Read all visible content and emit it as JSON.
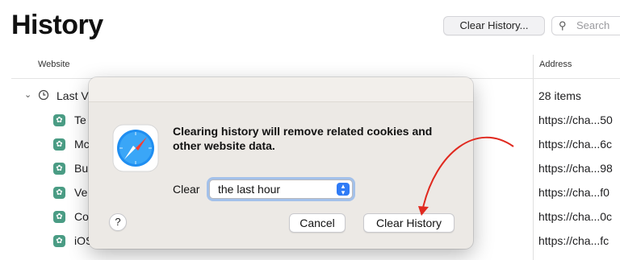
{
  "page": {
    "title": "History"
  },
  "toolbar": {
    "clear_history_label": "Clear History...",
    "search_placeholder": "Search"
  },
  "columns": {
    "website": "Website",
    "address": "Address"
  },
  "group": {
    "label": "Last V",
    "count": "28 items"
  },
  "rows": [
    {
      "site": "Te",
      "address": "https://cha...50"
    },
    {
      "site": "Mc",
      "address": "https://cha...6c"
    },
    {
      "site": "Bu",
      "address": "https://cha...98"
    },
    {
      "site": "Ve",
      "address": "https://cha...f0"
    },
    {
      "site": "Co",
      "address": "https://cha...0c"
    },
    {
      "site": "iOS",
      "address": "https://cha...fc"
    }
  ],
  "dialog": {
    "message": "Clearing history will remove related cookies and other website data.",
    "clear_label": "Clear",
    "period_selected": "the last hour",
    "help_label": "?",
    "cancel_label": "Cancel",
    "confirm_label": "Clear History"
  },
  "annotation": {
    "arrow_color": "#e0291f"
  },
  "colors": {
    "accent": "#2f7bf6",
    "site_icon": "#4a9c84"
  }
}
